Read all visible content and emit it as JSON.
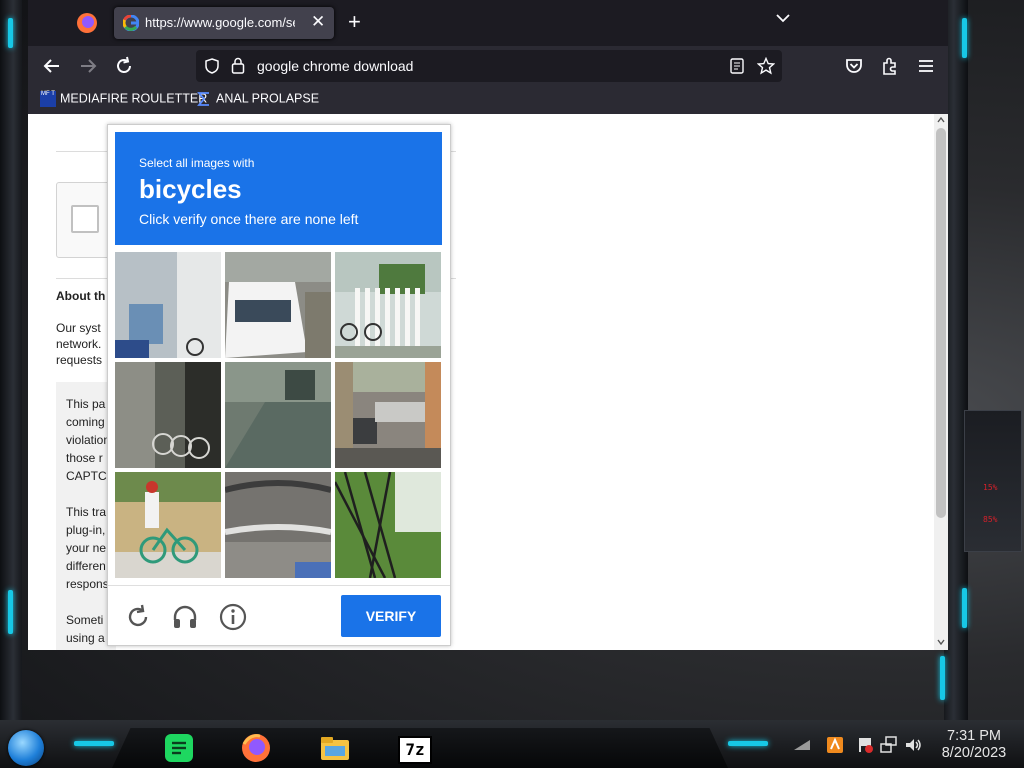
{
  "browser": {
    "tab_title": "https://www.google.com/search",
    "url_text": "google chrome download",
    "bookmarks": [
      {
        "label": "MEDIAFIRE ROULETTER",
        "icon_text": "MF T"
      },
      {
        "label": "ANAL PROLAPSE",
        "icon": "sigma-icon"
      }
    ]
  },
  "page": {
    "heading": "About th",
    "para": "Our syst\nnetwork.\nrequests",
    "box_para": "This pa\ncoming\nviolation\nthose r\nCAPTC\n\nThis tra\nplug-in,\nyour ne\ndifferen\nrespons\n\nSometi\nusing a"
  },
  "captcha": {
    "pre": "Select all images with",
    "object": "bicycles",
    "post": "Click verify once there are none left",
    "verify_label": "VERIFY",
    "accent": "#1a73e8"
  },
  "taskbar": {
    "sevenzip_label": "7z",
    "time": "7:31 PM",
    "date": "8/20/2023",
    "readout_top": "15%",
    "readout_bottom": "85%"
  }
}
